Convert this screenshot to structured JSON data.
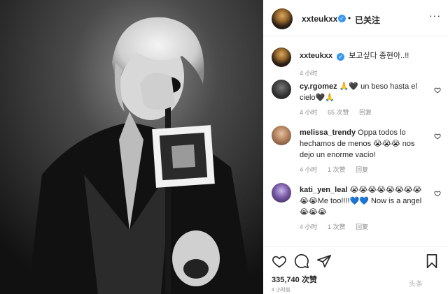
{
  "post": {
    "owner": "xxteukxx",
    "verified_mark": "✓",
    "separator": "•",
    "follow_state": "已关注",
    "more_icon": "more-horizontal-icon"
  },
  "caption": {
    "username": "xxteukxx",
    "text": "보고싶다 종현아..!!",
    "time": "4 小时"
  },
  "comments": [
    {
      "username": "cy.rgomez",
      "text": "🙏🖤 un beso hasta el cielo🖤🙏",
      "time": "4 小时",
      "likes": "65 次赞",
      "reply": "回复"
    },
    {
      "username": "melissa_trendy",
      "text": "Oppa todos lo hechamos de menos 😭😭😭 nos dejo un enorme vacío!",
      "time": "4 小时",
      "likes": "1 次赞",
      "reply": "回复"
    },
    {
      "username": "kati_yen_leal",
      "text": "😭😭😭😭😭😭😭😭😭😭Me too!!!!💙💙 Now is a angel😭😭😭",
      "time": "4 小时",
      "likes": "1 次赞",
      "reply": "回复"
    }
  ],
  "actions": {
    "like_icon": "heart-icon",
    "comment_icon": "comment-icon",
    "share_icon": "share-icon",
    "save_icon": "bookmark-icon"
  },
  "likes_count": "335,740 次赞",
  "post_time": "4 小时前",
  "watermark": "头条"
}
